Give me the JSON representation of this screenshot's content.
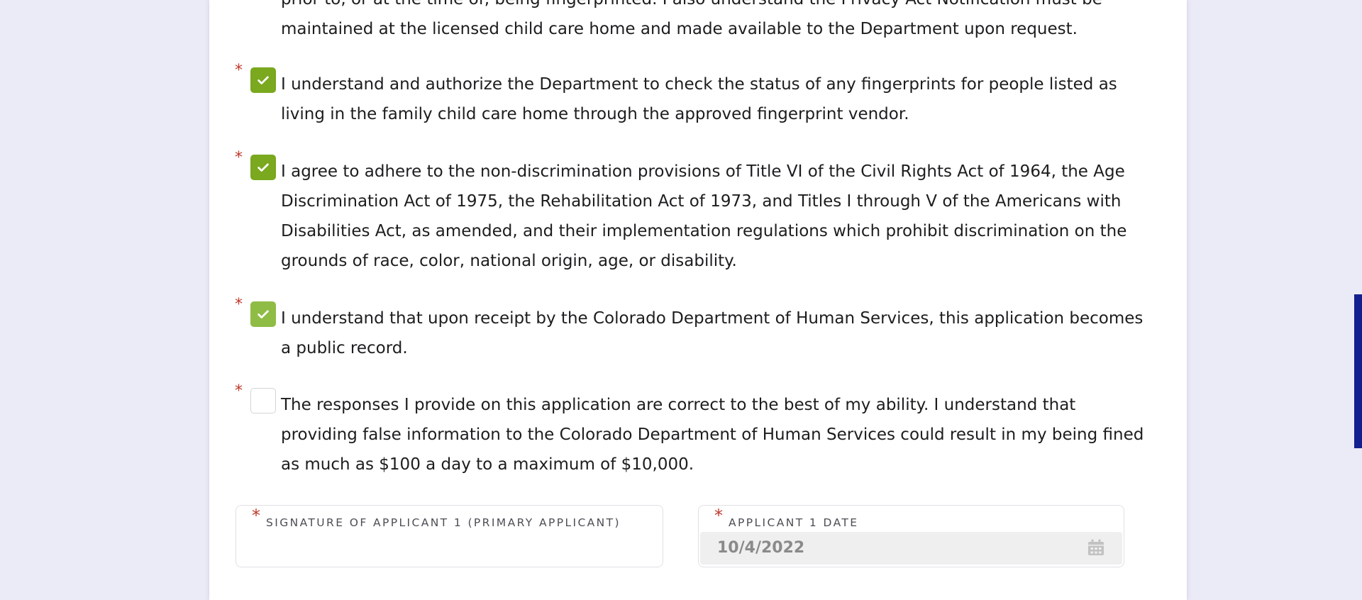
{
  "checklist": {
    "top_fragment": {
      "line1": "prior to, or at the time of, being fingerprinted. I also understand the Privacy Act Notification must be",
      "line2": "maintained at the licensed child care home and made available to the Department upon request."
    },
    "items": [
      {
        "text": "I understand and authorize the Department to check the status of any fingerprints for people listed as living in the family child care home through the approved fingerprint vendor.",
        "checked": true
      },
      {
        "text": "I agree to adhere to the non-discrimination provisions of Title VI of the Civil Rights Act of 1964, the Age Discrimination Act of 1975, the Rehabilitation Act of 1973, and Titles I through V of the Americans with Disabilities Act, as amended, and their implementation regulations which prohibit discrimination on the grounds of race, color, national origin, age, or disability.",
        "checked": true
      },
      {
        "text": "I understand that upon receipt by the Colorado Department of Human Services, this application becomes a public record.",
        "checked": true
      },
      {
        "text": "The responses I provide on this application are correct to the best of my ability. I understand that providing false information to the Colorado Department of Human Services could result in my being fined as much as $100 a day to a maximum of $10,000.",
        "checked": false
      }
    ],
    "required_marker": "*"
  },
  "signature_field": {
    "label": "SIGNATURE OF APPLICANT 1 (PRIMARY APPLICANT)",
    "value": ""
  },
  "date_field": {
    "label": "APPLICANT 1 DATE",
    "value": "10/4/2022",
    "icon": "calendar-icon"
  },
  "colors": {
    "checkbox_checked": "#7aa81f",
    "required_marker": "#c0392b",
    "scrollbar_thumb": "#141f8f",
    "background": "#ebeaf7"
  }
}
